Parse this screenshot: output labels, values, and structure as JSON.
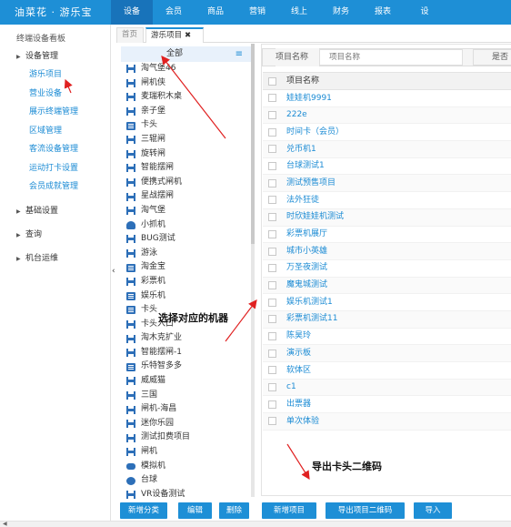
{
  "brand": "油菜花 · 游乐宝",
  "top_nav": [
    "设备",
    "会员",
    "商品",
    "营销",
    "线上",
    "财务",
    "报表",
    "设"
  ],
  "top_nav_active": 0,
  "sidebar": {
    "title": "终端设备看板",
    "group_device": "设备管理",
    "items": [
      "游乐项目",
      "营业设备",
      "展示终端管理",
      "区域管理",
      "客流设备管理",
      "运动打卡设置",
      "会员成就管理"
    ],
    "group_basic": "基础设置",
    "group_query": "查询",
    "group_ops": "机台运维"
  },
  "collapse_label": "‹",
  "tabs": {
    "home": "首页",
    "current": "游乐项目",
    "close": "✖"
  },
  "tree": {
    "all_label": "全部",
    "menu_icon": "≡",
    "items": [
      {
        "label": "淘气堡46",
        "icon": "reel"
      },
      {
        "label": "闸机侠",
        "icon": "reel"
      },
      {
        "label": "麦瑞积木桌",
        "icon": "reel"
      },
      {
        "label": "亲子堡",
        "icon": "reel"
      },
      {
        "label": "卡头",
        "icon": "card"
      },
      {
        "label": "三辊闸",
        "icon": "reel"
      },
      {
        "label": "旋转闸",
        "icon": "reel"
      },
      {
        "label": "智能摆闸",
        "icon": "reel"
      },
      {
        "label": "便携式闸机",
        "icon": "reel"
      },
      {
        "label": "星战摆闸",
        "icon": "reel"
      },
      {
        "label": "淘气堡",
        "icon": "reel"
      },
      {
        "label": "小抓机",
        "icon": "claw"
      },
      {
        "label": "BUG测试",
        "icon": "reel"
      },
      {
        "label": "游泳",
        "icon": "reel"
      },
      {
        "label": "淘金宝",
        "icon": "card"
      },
      {
        "label": "彩票机",
        "icon": "reel"
      },
      {
        "label": "娱乐机",
        "icon": "card"
      },
      {
        "label": "卡头",
        "icon": "card"
      },
      {
        "label": "卡头入口",
        "icon": "reel"
      },
      {
        "label": "淘木克扩业",
        "icon": "reel"
      },
      {
        "label": "智能摆闸-1",
        "icon": "reel"
      },
      {
        "label": "乐特智多多",
        "icon": "card"
      },
      {
        "label": "威威猫",
        "icon": "reel"
      },
      {
        "label": "三国",
        "icon": "reel"
      },
      {
        "label": "闸机-海昌",
        "icon": "reel"
      },
      {
        "label": "迷你乐园",
        "icon": "reel"
      },
      {
        "label": "测试扣费项目",
        "icon": "reel"
      },
      {
        "label": "闸机",
        "icon": "reel"
      },
      {
        "label": "模拟机",
        "icon": "pad"
      },
      {
        "label": "台球",
        "icon": "drum"
      },
      {
        "label": "VR设备测试",
        "icon": "reel"
      }
    ]
  },
  "tree_buttons": {
    "add": "新增分类",
    "edit": "编辑",
    "delete": "删除"
  },
  "filter": {
    "label": "项目名称",
    "placeholder": "项目名称",
    "label2": "是否"
  },
  "grid": {
    "header": "项目名称",
    "rows": [
      "娃娃机9991",
      "222e",
      "时间卡（会员）",
      "兑币机1",
      "台球测试1",
      "测试预售项目",
      "法外狂徒",
      "时欣娃娃机测试",
      "彩票机展厅",
      "城市小英雄",
      "万圣夜测试",
      "魔鬼城测试",
      "娱乐机测试1",
      "彩票机测试11",
      "陈昊玲",
      "演示板",
      "软体区",
      "c1",
      "出票器",
      "单次体验"
    ]
  },
  "grid_buttons": {
    "add": "新增项目",
    "export": "导出项目二维码",
    "import": "导入"
  },
  "annotations": {
    "select_machine": "选择对应的机器",
    "export_qr": "导出卡头二维码"
  },
  "colors": {
    "primary": "#1e8fd6",
    "primary_dark": "#1873ba",
    "link": "#1b8bd4"
  }
}
